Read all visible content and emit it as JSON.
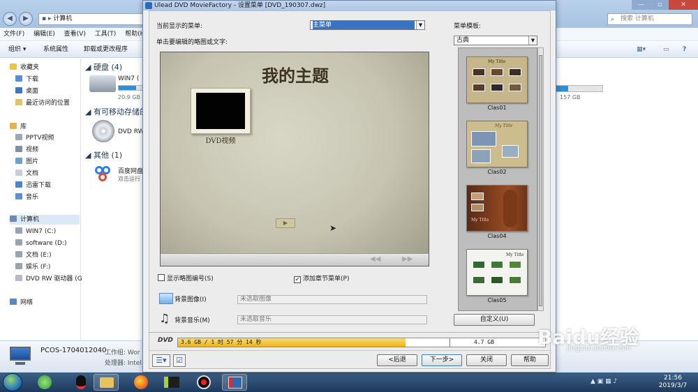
{
  "explorer": {
    "address": "计算机",
    "search_placeholder": "搜索 计算机",
    "menu": [
      "文件(F)",
      "编辑(E)",
      "查看(V)",
      "工具(T)",
      "帮助(H)"
    ],
    "toolbar": [
      "组织 ▾",
      "系统属性",
      "卸载或更改程序"
    ],
    "nav": {
      "favorites": "收藏夹",
      "downloads": "下载",
      "desktop": "桌面",
      "recent": "最近访问的位置",
      "library": "库",
      "pptv": "PPTV视频",
      "videos": "视频",
      "pictures": "图片",
      "documents": "文档",
      "xunlei": "迅雷下载",
      "music": "音乐",
      "computer": "计算机",
      "drive_c": "WIN7 (C:)",
      "drive_d": "software (D:)",
      "drive_e": "文档 (E:)",
      "drive_f": "娱乐 (F:)",
      "drive_g": "DVD RW 驱动器 (G",
      "network": "网络"
    },
    "groups": {
      "hard_disk": "硬盘 (4)",
      "removable": "有可移动存储的",
      "other": "其他 (1)"
    },
    "drives": {
      "win7_name": "WIN7 (",
      "win7_free": "20.9 GB",
      "dvd_name": "DVD RW",
      "baidu_name": "百度网盘",
      "baidu_sub": "双击运行",
      "right_size": "157 GB"
    },
    "details": {
      "pc_name": "PCOS-1704012040",
      "workgroup": "工作组: Wor",
      "cpu": "处理器: Intel"
    },
    "win7_used_fraction": 0.7,
    "right_drive_used_fraction": 0.25
  },
  "dialog": {
    "title": "Ulead DVD MovieFactory - 设置菜单    [DVD_190307.dwz]",
    "current_menu_label": "当前显示的菜单:",
    "current_menu_value": "主菜单",
    "click_edit_label": "单击要编辑的略图或文字:",
    "preview": {
      "title": "我的主题",
      "thumb_caption": "DVD视频",
      "next_glyph": "▶"
    },
    "template_label": "菜单模板:",
    "template_value": "古典",
    "templates": [
      "Clas01",
      "Clas02",
      "Clas04",
      "Clas05"
    ],
    "template_titles": [
      "My Title",
      "My Title",
      "My Title",
      "My Title"
    ],
    "show_thumb_numbers": "显示略图编号(S)",
    "show_thumb_numbers_checked": false,
    "add_chapter_menu": "添加章节菜单(P)",
    "add_chapter_menu_checked": true,
    "bg_image_label": "背景图像(I)",
    "bg_image_value": "未选取图像",
    "bg_music_label": "背景音乐(M)",
    "bg_music_value": "未选取音乐",
    "custom_button": "自定义(U)",
    "dvd_label": "DVD",
    "disc_usage": "3.6 GB / 1 时 57 分 14 秒",
    "disc_capacity": "4.7 GB",
    "disc_used_fraction": 0.62,
    "buttons": {
      "back": "<后退",
      "next": "下一步>",
      "close": "关闭",
      "help": "帮助"
    }
  },
  "taskbar": {
    "time": "21:56",
    "date": "2019/3/7"
  },
  "watermark": {
    "logo": "Baidu经验",
    "url": "jingyan.baidu.com"
  },
  "colors": {
    "selection": "#3b73c4",
    "disc_fill": "#f0b21a",
    "taskbar": "#1d3a5c"
  }
}
